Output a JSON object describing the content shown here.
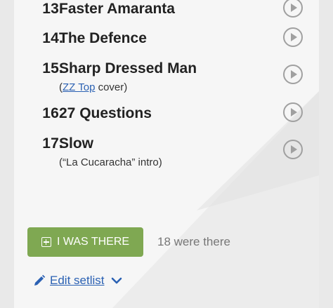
{
  "songs": [
    {
      "number": "13.",
      "title": "Faster Amaranta",
      "note": null
    },
    {
      "number": "14.",
      "title": "The Defence",
      "note": null
    },
    {
      "number": "15.",
      "title": "Sharp Dressed Man",
      "note": {
        "open": "(",
        "link": "ZZ Top",
        "rest": " cover)"
      }
    },
    {
      "number": "16.",
      "title": "27 Questions",
      "note": null
    },
    {
      "number": "17.",
      "title": "Slow",
      "note": {
        "open": "(“La Cucaracha” intro)",
        "link": "",
        "rest": ""
      }
    }
  ],
  "attendance": {
    "button_label": "I WAS THERE",
    "count_text": "18 were there"
  },
  "edit": {
    "label": "Edit setlist"
  },
  "icons": {
    "play": "play-circle-icon",
    "plus": "plus-square-icon",
    "pencil": "pencil-icon",
    "chevron": "chevron-down-icon"
  },
  "colors": {
    "accent_green": "#7fa852",
    "link_blue": "#2b61b3",
    "text": "#222222"
  }
}
